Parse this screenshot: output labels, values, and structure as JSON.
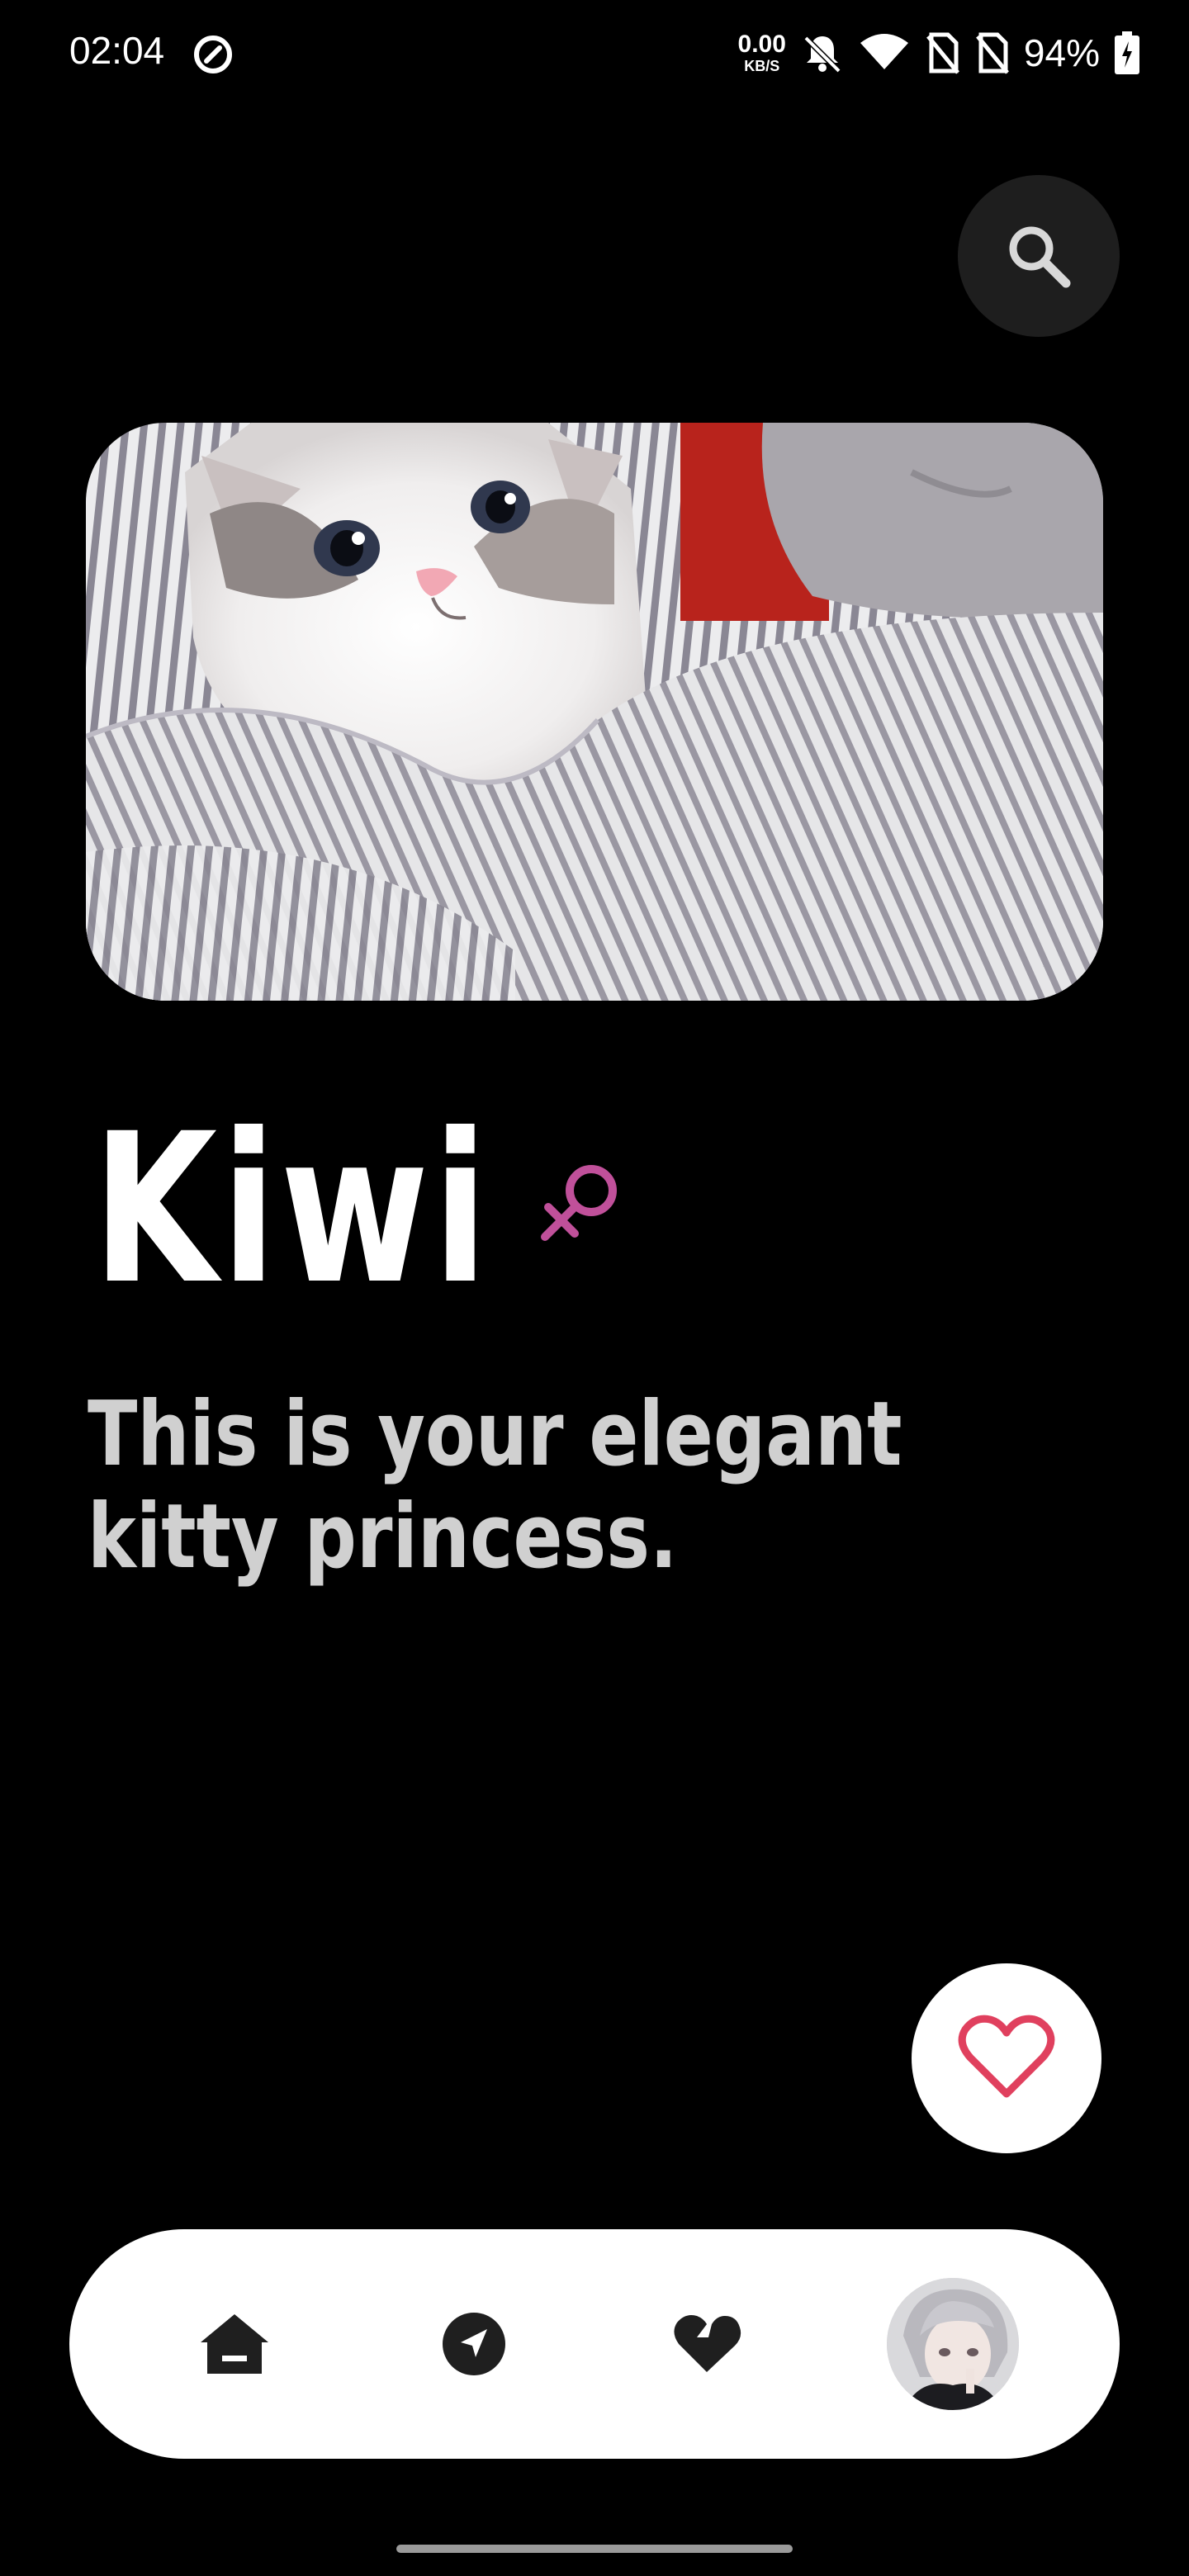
{
  "status_bar": {
    "time": "02:04",
    "net_speed_value": "0.00",
    "net_speed_unit": "KB/S",
    "battery": "94%"
  },
  "pet": {
    "name": "Kiwi",
    "gender_icon": "female-symbol-icon",
    "description": "This is your elegant kitty princess."
  },
  "colors": {
    "background": "#000000",
    "accent_like": "#e0405e",
    "gender": "#c0509a",
    "nav_background": "#ffffff"
  },
  "nav": {
    "items": [
      {
        "icon": "home-icon"
      },
      {
        "icon": "explore-icon"
      },
      {
        "icon": "heart-icon"
      },
      {
        "icon": "avatar"
      }
    ]
  }
}
